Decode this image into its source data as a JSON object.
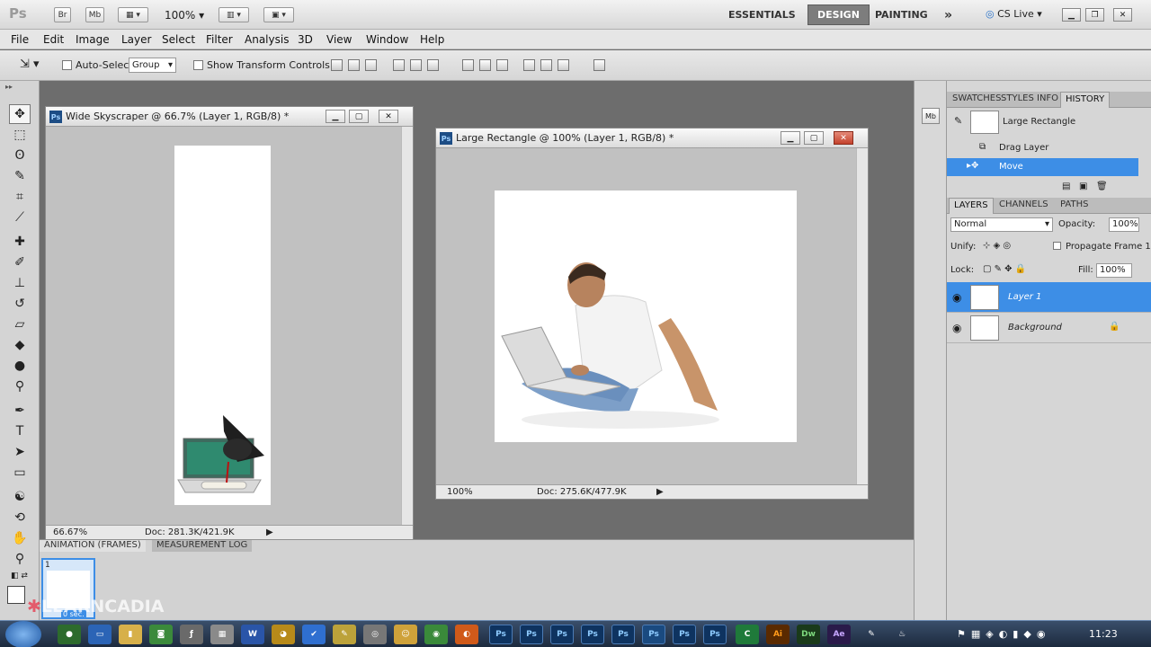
{
  "appbar": {
    "app_logo": "Ps",
    "bridge_label": "Br",
    "minibridge_label": "Mb",
    "zoom": "100%",
    "workspaces": [
      "ESSENTIALS",
      "DESIGN",
      "PAINTING"
    ],
    "active_workspace": "DESIGN",
    "more_glyph": "»",
    "cslive": "CS Live"
  },
  "menu": [
    "File",
    "Edit",
    "Image",
    "Layer",
    "Select",
    "Filter",
    "Analysis",
    "3D",
    "View",
    "Window",
    "Help"
  ],
  "options": {
    "auto_select_label": "Auto-Select:",
    "auto_select_value": "Group",
    "show_transform_label": "Show Transform Controls"
  },
  "doc1": {
    "badge": "Ps",
    "title": "Wide Skyscraper @ 66.7% (Layer 1, RGB/8) *",
    "zoom": "66.67%",
    "doc_info": "Doc: 281.3K/421.9K"
  },
  "doc2": {
    "badge": "Ps",
    "title": "Large Rectangle @ 100% (Layer 1, RGB/8) *",
    "zoom": "100%",
    "doc_info": "Doc: 275.6K/477.9K"
  },
  "history_panel": {
    "tabs": [
      "SWATCHES",
      "STYLES",
      "INFO",
      "HISTORY"
    ],
    "active_tab": "HISTORY",
    "snapshot": "Large Rectangle",
    "items": [
      "Drag Layer",
      "Move"
    ],
    "selected_item": "Move"
  },
  "layers_panel": {
    "tabs": [
      "LAYERS",
      "CHANNELS",
      "PATHS"
    ],
    "active_tab": "LAYERS",
    "blend_mode": "Normal",
    "opacity_label": "Opacity:",
    "opacity": "100%",
    "unify_label": "Unify:",
    "propagate_label": "Propagate Frame 1",
    "lock_label": "Lock:",
    "fill_label": "Fill:",
    "fill": "100%",
    "layers": [
      {
        "name": "Layer 1",
        "selected": true
      },
      {
        "name": "Background",
        "selected": false,
        "locked": true
      }
    ]
  },
  "animation_panel": {
    "tabs": [
      "ANIMATION (FRAMES)",
      "MEASUREMENT LOG"
    ],
    "frame_number": "1",
    "frame_time": "0 sec."
  },
  "watermark": "LEARNCADIA",
  "taskbar": {
    "clock": "11:23"
  },
  "colors": {
    "selection_blue": "#3d8ee6",
    "ps_blue": "#1d4d85",
    "close_red": "#c4422c"
  }
}
